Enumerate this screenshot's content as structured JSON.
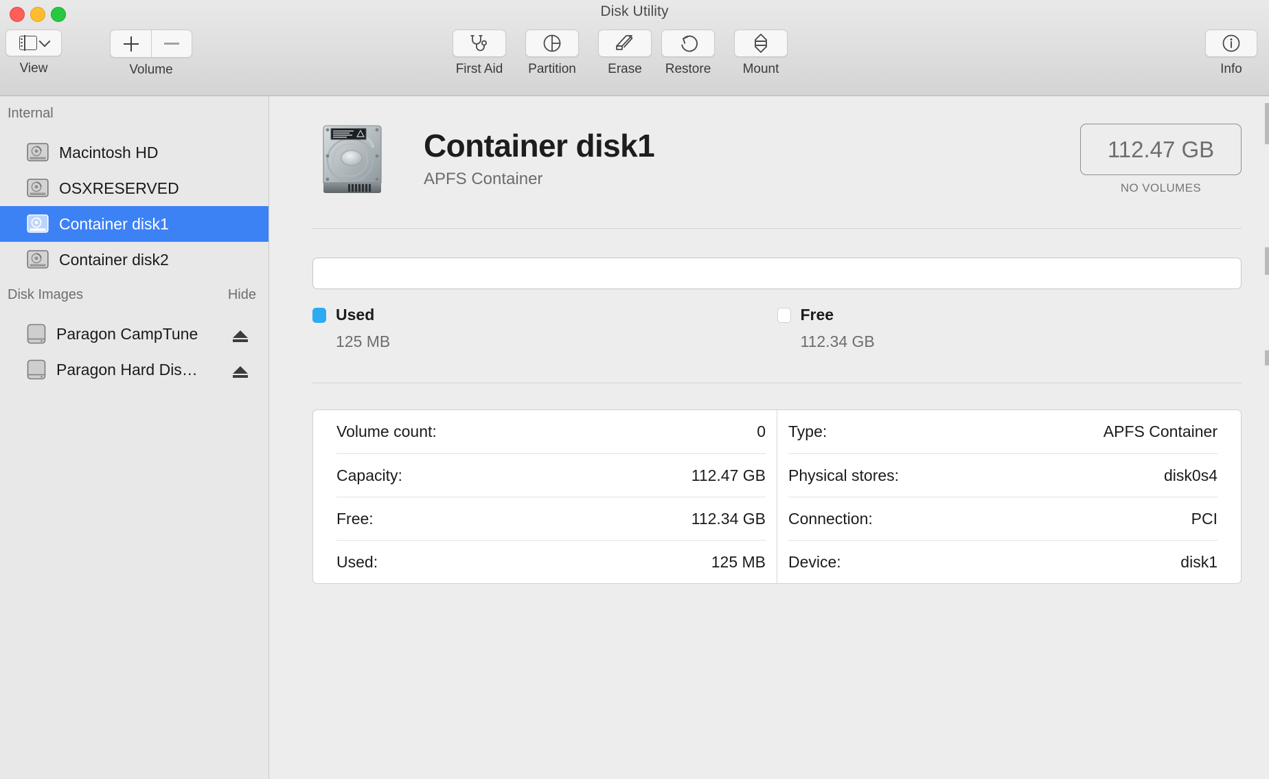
{
  "window": {
    "title": "Disk Utility"
  },
  "toolbar": {
    "view": {
      "label": "View",
      "icon": "sidebar-icon",
      "chevron": "chevron-down-icon"
    },
    "volume": {
      "label": "Volume",
      "add_icon": "plus-icon",
      "remove_icon": "minus-icon"
    },
    "actions": [
      {
        "label": "First Aid",
        "icon": "stethoscope-icon"
      },
      {
        "label": "Partition",
        "icon": "pie-chart-icon"
      },
      {
        "label": "Erase",
        "icon": "eraser-icon"
      },
      {
        "label": "Restore",
        "icon": "undo-arrow-icon"
      },
      {
        "label": "Mount",
        "icon": "mount-eject-icon"
      }
    ],
    "info": {
      "label": "Info",
      "icon": "info-circle-icon"
    }
  },
  "sidebar": {
    "sections": [
      {
        "title": "Internal",
        "action": "",
        "items": [
          {
            "name": "Macintosh HD",
            "icon": "hard-drive-icon",
            "selected": false,
            "ejectable": false
          },
          {
            "name": "OSXRESERVED",
            "icon": "hard-drive-icon",
            "selected": false,
            "ejectable": false
          },
          {
            "name": "Container disk1",
            "icon": "hard-drive-icon",
            "selected": true,
            "ejectable": false
          },
          {
            "name": "Container disk2",
            "icon": "hard-drive-icon",
            "selected": false,
            "ejectable": false
          }
        ]
      },
      {
        "title": "Disk Images",
        "action": "Hide",
        "items": [
          {
            "name": "Paragon CampTune",
            "icon": "disk-image-icon",
            "selected": false,
            "ejectable": true
          },
          {
            "name": "Paragon Hard Dis…",
            "icon": "disk-image-icon",
            "selected": false,
            "ejectable": true
          }
        ]
      }
    ]
  },
  "main": {
    "disk_icon": "hard-drive-large-icon",
    "title": "Container disk1",
    "subtitle": "APFS Container",
    "capacity_badge": {
      "value": "112.47 GB",
      "caption": "NO VOLUMES"
    },
    "usage": {
      "used_percent": 0.11,
      "legend": [
        {
          "name": "Used",
          "value": "125 MB",
          "color": "#2cabf2"
        },
        {
          "name": "Free",
          "value": "112.34 GB",
          "color": "#ffffff"
        }
      ]
    },
    "info": {
      "left": [
        {
          "key": "Volume count:",
          "value": "0"
        },
        {
          "key": "Capacity:",
          "value": "112.47 GB"
        },
        {
          "key": "Free:",
          "value": "112.34 GB"
        },
        {
          "key": "Used:",
          "value": "125 MB"
        }
      ],
      "right": [
        {
          "key": "Type:",
          "value": "APFS Container"
        },
        {
          "key": "Physical stores:",
          "value": "disk0s4"
        },
        {
          "key": "Connection:",
          "value": "PCI"
        },
        {
          "key": "Device:",
          "value": "disk1"
        }
      ]
    }
  },
  "colors": {
    "accent_blue": "#2cabf2",
    "selection_blue": "#3d82f5"
  }
}
